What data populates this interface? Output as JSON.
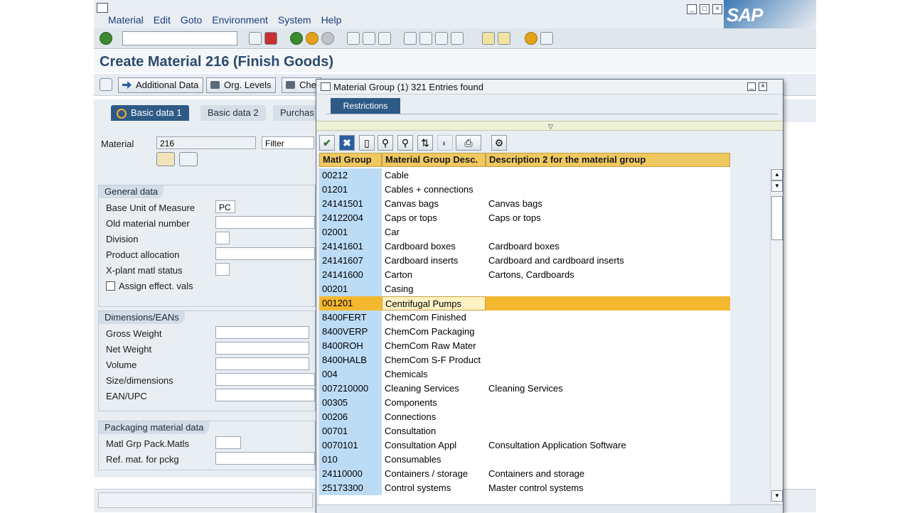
{
  "menu": [
    "Material",
    "Edit",
    "Goto",
    "Environment",
    "System",
    "Help"
  ],
  "brand": "SAP",
  "page_title": "Create Material 216 (Finish Goods)",
  "app_toolbar": {
    "additional_data": "Additional Data",
    "org_levels": "Org. Levels",
    "check_partial": "Che"
  },
  "tabs": [
    "Basic data 1",
    "Basic data 2",
    "Purchas"
  ],
  "material": {
    "label": "Material",
    "value": "216",
    "filter": "Filter"
  },
  "general_data": {
    "title": "General data",
    "base_uom_label": "Base Unit of Measure",
    "base_uom_value": "PC",
    "old_material_label": "Old material number",
    "division_label": "Division",
    "product_alloc_label": "Product allocation",
    "xplant_label": "X-plant matl status",
    "assign_label": "Assign effect. vals"
  },
  "dimensions": {
    "title": "Dimensions/EANs",
    "gross_weight": "Gross Weight",
    "net_weight": "Net Weight",
    "volume": "Volume",
    "size_dimensions": "Size/dimensions",
    "ean_upc": "EAN/UPC"
  },
  "packaging": {
    "title": "Packaging material data",
    "matl_grp_pack": "Matl Grp Pack.Matls",
    "ref_mat": "Ref. mat. for pckg"
  },
  "dialog": {
    "title": "Material Group (1)  321 Entries found",
    "restrictions_tab": "Restrictions",
    "columns": [
      "Matl Group",
      "Material Group Desc.",
      "Description 2 for the material group"
    ],
    "selected_index": 9,
    "rows": [
      [
        "00212",
        "Cable",
        ""
      ],
      [
        "01201",
        "Cables + connections",
        ""
      ],
      [
        "24141501",
        "Canvas bags",
        "Canvas bags"
      ],
      [
        "24122004",
        "Caps or tops",
        "Caps or tops"
      ],
      [
        "02001",
        "Car",
        ""
      ],
      [
        "24141601",
        "Cardboard boxes",
        "Cardboard boxes"
      ],
      [
        "24141607",
        "Cardboard inserts",
        "Cardboard and cardboard inserts"
      ],
      [
        "24141600",
        "Carton",
        "Cartons, Cardboards"
      ],
      [
        "00201",
        "Casing",
        ""
      ],
      [
        "001201",
        "Centrifugal Pumps",
        ""
      ],
      [
        "8400FERT",
        "ChemCom Finished",
        ""
      ],
      [
        "8400VERP",
        "ChemCom Packaging",
        ""
      ],
      [
        "8400ROH",
        "ChemCom Raw Mater",
        ""
      ],
      [
        "8400HALB",
        "ChemCom S-F Product",
        ""
      ],
      [
        "004",
        "Chemicals",
        ""
      ],
      [
        "007210000",
        "Cleaning Services",
        "Cleaning Services"
      ],
      [
        "00305",
        "Components",
        ""
      ],
      [
        "00206",
        "Connections",
        ""
      ],
      [
        "00701",
        "Consultation",
        ""
      ],
      [
        "0070101",
        "Consultation Appl",
        "Consultation Application Software"
      ],
      [
        "010",
        "Consumables",
        ""
      ],
      [
        "24110000",
        "Containers / storage",
        "Containers and storage"
      ],
      [
        "25173300",
        "Control systems",
        "Master control systems"
      ]
    ]
  }
}
